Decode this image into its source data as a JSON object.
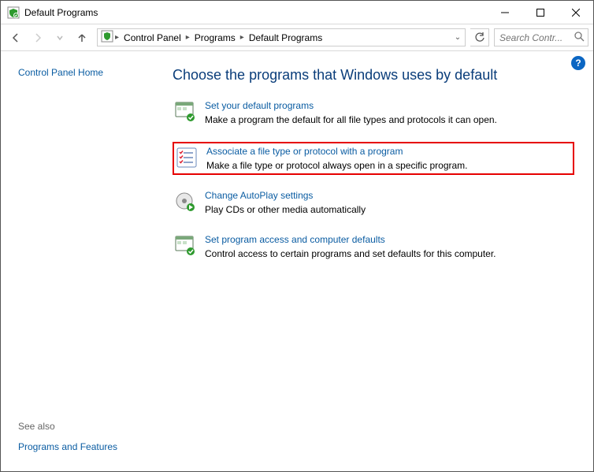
{
  "window": {
    "title": "Default Programs"
  },
  "breadcrumb": {
    "items": [
      "Control Panel",
      "Programs",
      "Default Programs"
    ]
  },
  "search": {
    "placeholder": "Search Contr..."
  },
  "sidebar": {
    "home": "Control Panel Home",
    "see_also_label": "See also",
    "see_also_link": "Programs and Features"
  },
  "main": {
    "heading": "Choose the programs that Windows uses by default",
    "options": [
      {
        "title": "Set your default programs",
        "desc": "Make a program the default for all file types and protocols it can open."
      },
      {
        "title": "Associate a file type or protocol with a program",
        "desc": "Make a file type or protocol always open in a specific program."
      },
      {
        "title": "Change AutoPlay settings",
        "desc": "Play CDs or other media automatically"
      },
      {
        "title": "Set program access and computer defaults",
        "desc": "Control access to certain programs and set defaults for this computer."
      }
    ]
  },
  "help": "?",
  "icons": {
    "search_glyph": "🔍"
  }
}
